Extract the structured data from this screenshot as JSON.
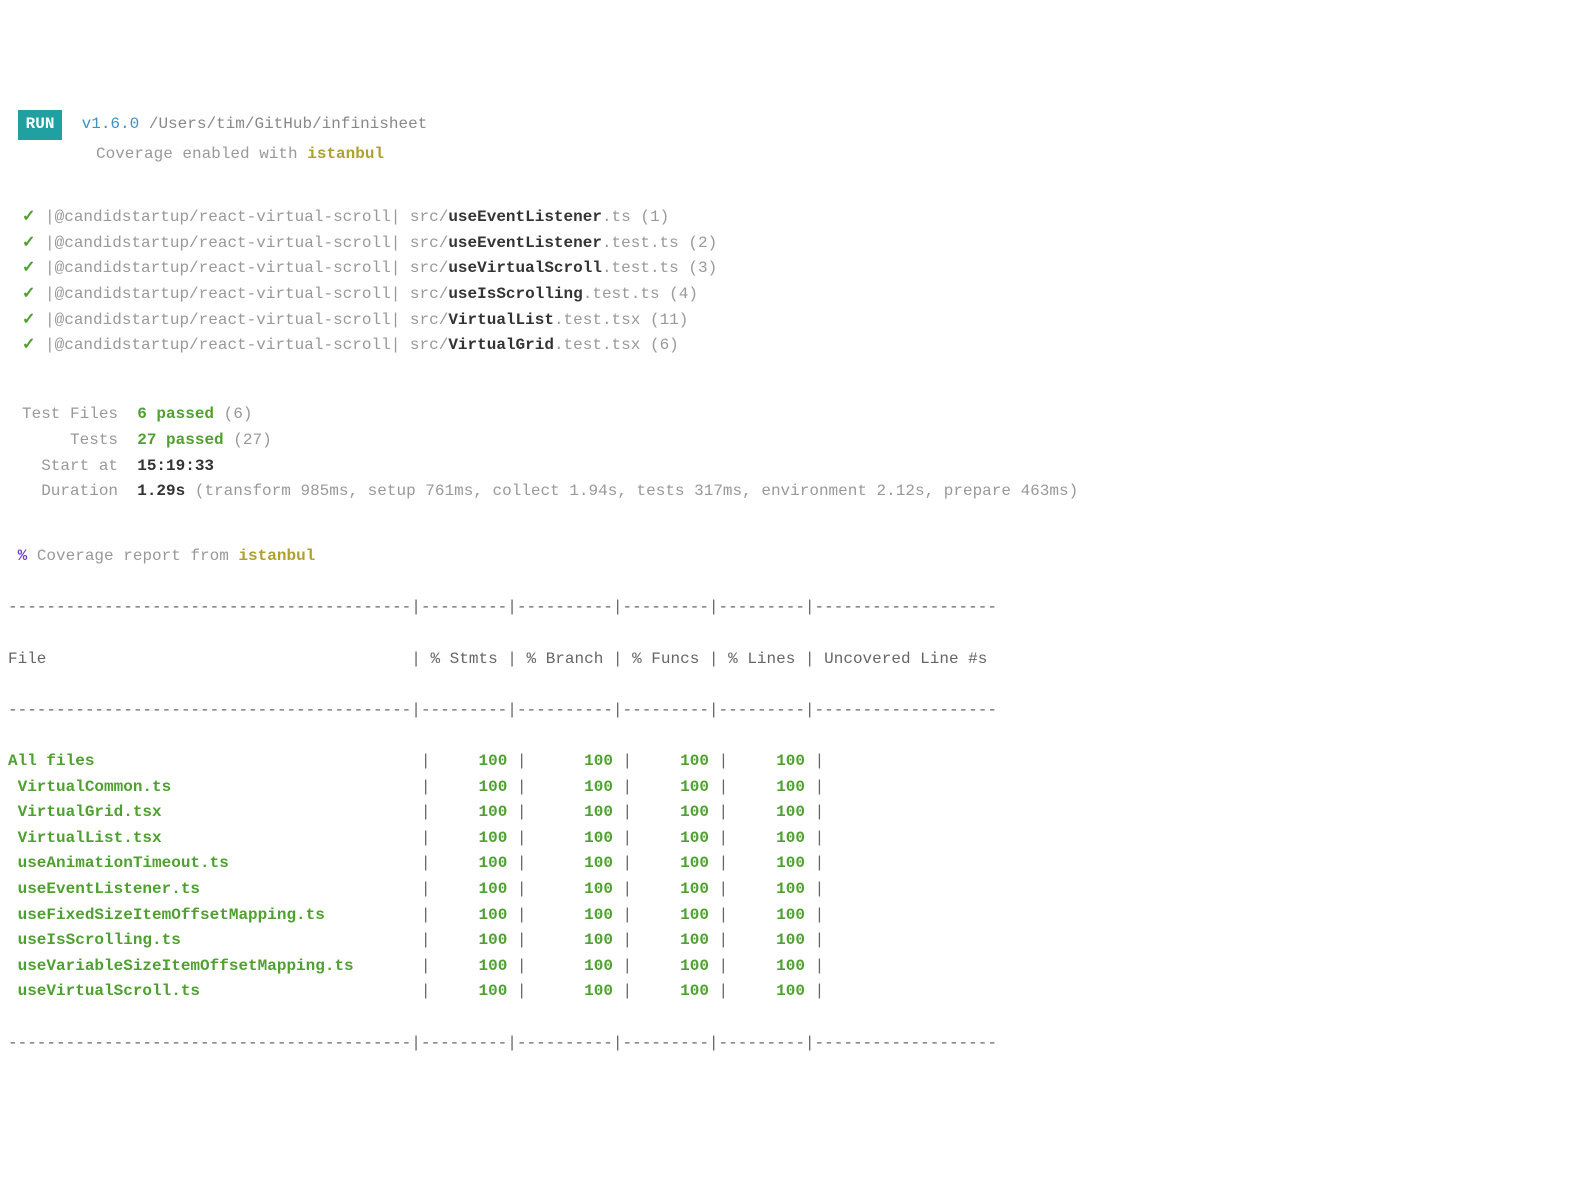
{
  "header": {
    "badge": "RUN",
    "version": "v1.6.0",
    "path": "/Users/tim/GitHub/infinisheet",
    "coverage_prefix": "Coverage enabled with ",
    "coverage_tool": "istanbul"
  },
  "tests": [
    {
      "pkg": "@candidstartup/react-virtual-scroll",
      "dir": "src/",
      "name": "useEventListener",
      "ext": ".ts",
      "count": "(1)"
    },
    {
      "pkg": "@candidstartup/react-virtual-scroll",
      "dir": "src/",
      "name": "useEventListener",
      "ext": ".test.ts",
      "count": "(2)"
    },
    {
      "pkg": "@candidstartup/react-virtual-scroll",
      "dir": "src/",
      "name": "useVirtualScroll",
      "ext": ".test.ts",
      "count": "(3)"
    },
    {
      "pkg": "@candidstartup/react-virtual-scroll",
      "dir": "src/",
      "name": "useIsScrolling",
      "ext": ".test.ts",
      "count": "(4)"
    },
    {
      "pkg": "@candidstartup/react-virtual-scroll",
      "dir": "src/",
      "name": "VirtualList",
      "ext": ".test.tsx",
      "count": "(11)"
    },
    {
      "pkg": "@candidstartup/react-virtual-scroll",
      "dir": "src/",
      "name": "VirtualGrid",
      "ext": ".test.tsx",
      "count": "(6)"
    }
  ],
  "summary": {
    "test_files_label": "Test Files",
    "test_files_pass": "6 passed",
    "test_files_total": "(6)",
    "tests_label": "Tests",
    "tests_pass": "27 passed",
    "tests_total": "(27)",
    "start_label": "Start at",
    "start_time": "15:19:33",
    "duration_label": "Duration",
    "duration_value": "1.29s",
    "duration_detail": "(transform 985ms, setup 761ms, collect 1.94s, tests 317ms, environment 2.12s, prepare 463ms)"
  },
  "coverage": {
    "percent": "%",
    "report_prefix": " Coverage report from ",
    "report_tool": "istanbul",
    "divider": "------------------------------------------|---------|----------|---------|---------|-------------------",
    "header_row": "File                                      | % Stmts | % Branch | % Funcs | % Lines | Uncovered Line #s ",
    "rows": [
      {
        "file": "All files",
        "pad": "                                 ",
        "s": "100",
        "b": "100",
        "f": "100",
        "l": "100"
      },
      {
        "file": " VirtualCommon.ts",
        "pad": "                         ",
        "s": "100",
        "b": "100",
        "f": "100",
        "l": "100"
      },
      {
        "file": " VirtualGrid.tsx",
        "pad": "                          ",
        "s": "100",
        "b": "100",
        "f": "100",
        "l": "100"
      },
      {
        "file": " VirtualList.tsx",
        "pad": "                          ",
        "s": "100",
        "b": "100",
        "f": "100",
        "l": "100"
      },
      {
        "file": " useAnimationTimeout.ts",
        "pad": "                   ",
        "s": "100",
        "b": "100",
        "f": "100",
        "l": "100"
      },
      {
        "file": " useEventListener.ts",
        "pad": "                      ",
        "s": "100",
        "b": "100",
        "f": "100",
        "l": "100"
      },
      {
        "file": " useFixedSizeItemOffsetMapping.ts",
        "pad": "         ",
        "s": "100",
        "b": "100",
        "f": "100",
        "l": "100"
      },
      {
        "file": " useIsScrolling.ts",
        "pad": "                        ",
        "s": "100",
        "b": "100",
        "f": "100",
        "l": "100"
      },
      {
        "file": " useVariableSizeItemOffsetMapping.ts",
        "pad": "      ",
        "s": "100",
        "b": "100",
        "f": "100",
        "l": "100"
      },
      {
        "file": " useVirtualScroll.ts",
        "pad": "                      ",
        "s": "100",
        "b": "100",
        "f": "100",
        "l": "100"
      }
    ]
  }
}
